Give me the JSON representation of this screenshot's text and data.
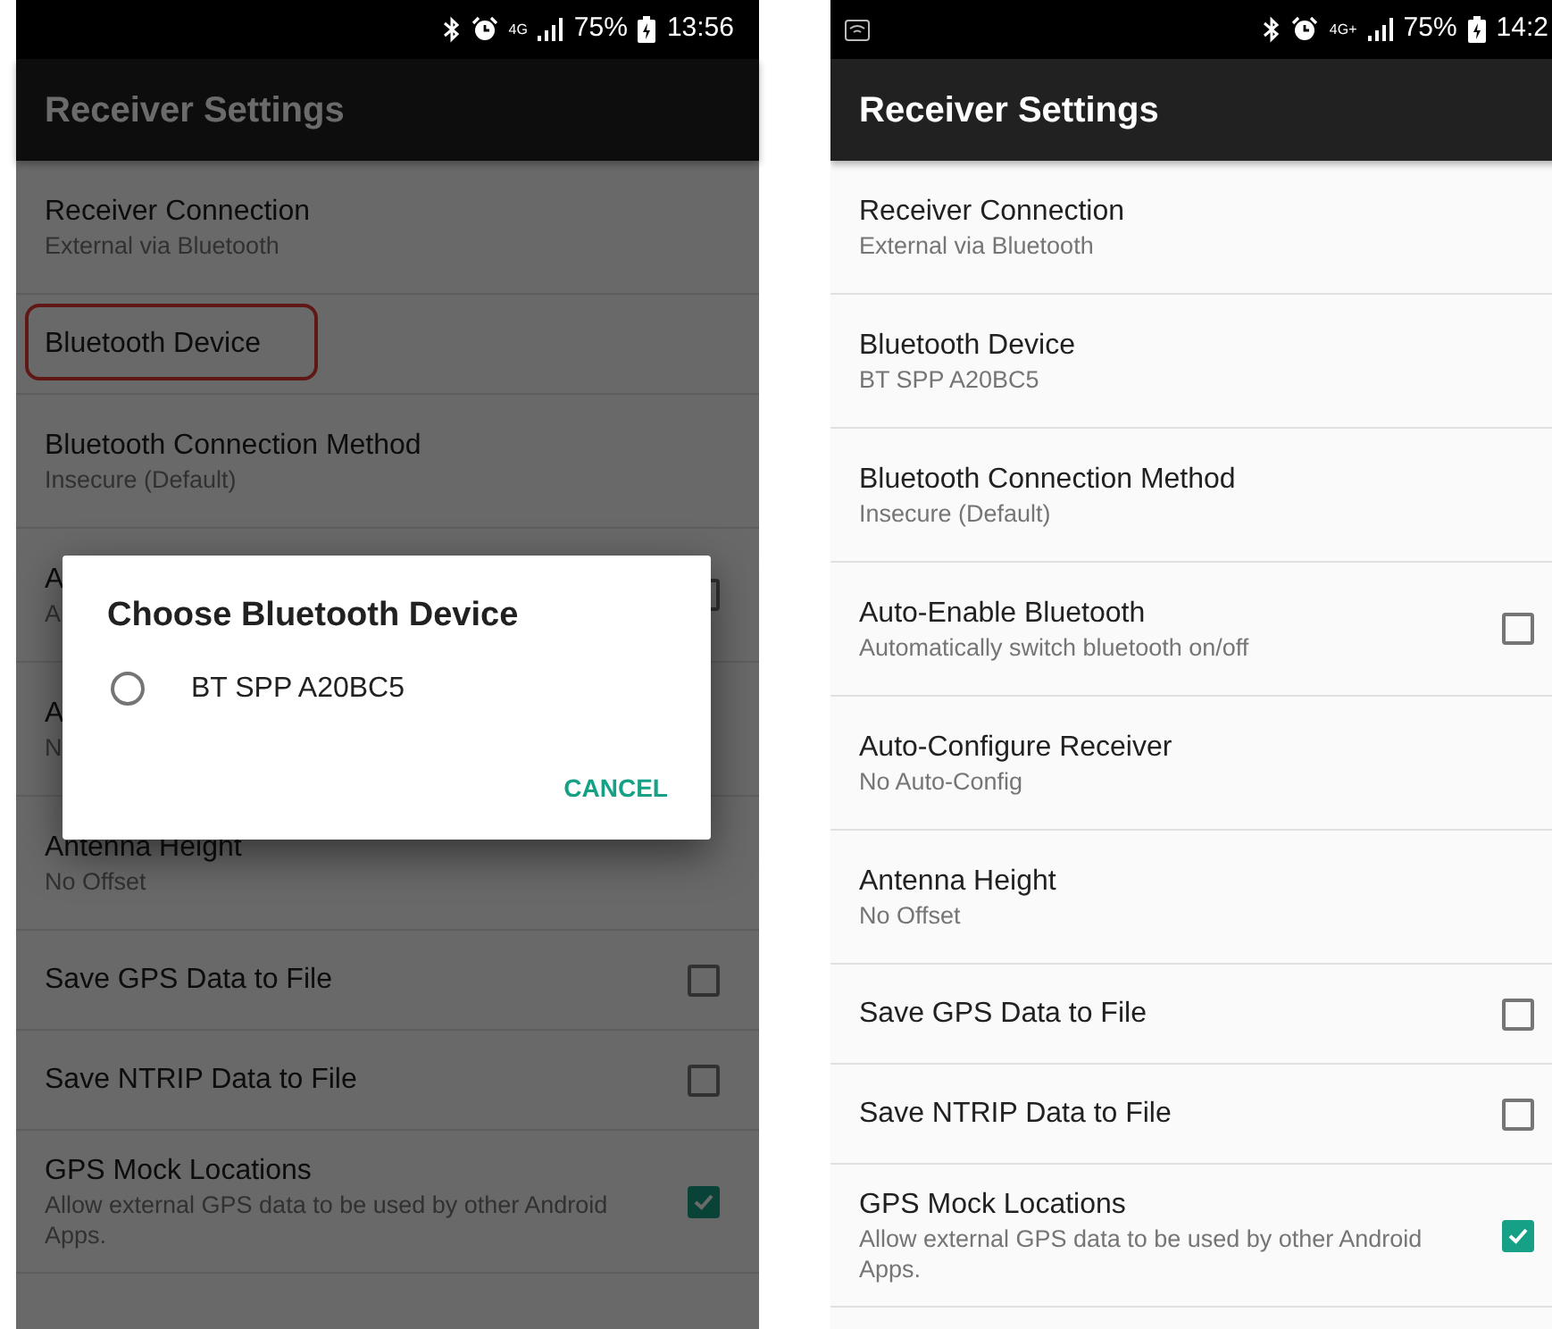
{
  "screens": [
    {
      "status_bar": {
        "notification_icon": false,
        "network": "4G",
        "battery": "75%",
        "time": "13:56"
      },
      "app_bar": {
        "title": "Receiver Settings"
      },
      "dimmed": true,
      "items": [
        {
          "kind": "text",
          "title": "Receiver Connection",
          "summary": "External via Bluetooth",
          "highlighted": false
        },
        {
          "kind": "text",
          "title": "Bluetooth Device",
          "highlighted": true
        },
        {
          "kind": "text",
          "title": "Bluetooth Connection Method",
          "summary": "Insecure (Default)",
          "highlighted": false
        },
        {
          "kind": "checkbox",
          "title": "A",
          "summary": "A",
          "checked": false,
          "highlighted": false
        },
        {
          "kind": "text",
          "title": "A",
          "summary": "N",
          "highlighted": false
        },
        {
          "kind": "text",
          "title": "Antenna Height",
          "summary": "No Offset",
          "highlighted": false
        },
        {
          "kind": "checkbox",
          "title": "Save GPS Data to File",
          "checked": false,
          "highlighted": false
        },
        {
          "kind": "checkbox",
          "title": "Save NTRIP Data to File",
          "checked": false,
          "highlighted": false
        },
        {
          "kind": "checkbox",
          "title": "GPS Mock Locations",
          "summary": "Allow external GPS data to be used by other Android Apps.",
          "checked": true,
          "highlighted": false
        }
      ],
      "dialog": {
        "title": "Choose Bluetooth Device",
        "options": [
          {
            "label": "BT SPP A20BC5",
            "selected": false
          }
        ],
        "button": "CANCEL"
      }
    },
    {
      "status_bar": {
        "notification_icon": true,
        "network": "4G+",
        "battery": "75%",
        "time": "14:2"
      },
      "app_bar": {
        "title": "Receiver Settings"
      },
      "dimmed": false,
      "items": [
        {
          "kind": "text",
          "title": "Receiver Connection",
          "summary": "External via Bluetooth",
          "highlighted": false
        },
        {
          "kind": "text",
          "title": "Bluetooth Device",
          "summary": "BT SPP A20BC5",
          "highlighted": false
        },
        {
          "kind": "text",
          "title": "Bluetooth Connection Method",
          "summary": "Insecure (Default)",
          "highlighted": false
        },
        {
          "kind": "checkbox",
          "title": "Auto-Enable Bluetooth",
          "summary": "Automatically switch bluetooth on/off",
          "checked": false,
          "highlighted": false
        },
        {
          "kind": "text",
          "title": "Auto-Configure Receiver",
          "summary": "No Auto-Config",
          "highlighted": false
        },
        {
          "kind": "text",
          "title": "Antenna Height",
          "summary": "No Offset",
          "highlighted": false
        },
        {
          "kind": "checkbox",
          "title": "Save GPS Data to File",
          "checked": false,
          "highlighted": false
        },
        {
          "kind": "checkbox",
          "title": "Save NTRIP Data to File",
          "checked": false,
          "highlighted": false
        },
        {
          "kind": "checkbox",
          "title": "GPS Mock Locations",
          "summary": "Allow external GPS data to be used by other Android Apps.",
          "checked": true,
          "highlighted": false
        }
      ]
    }
  ]
}
